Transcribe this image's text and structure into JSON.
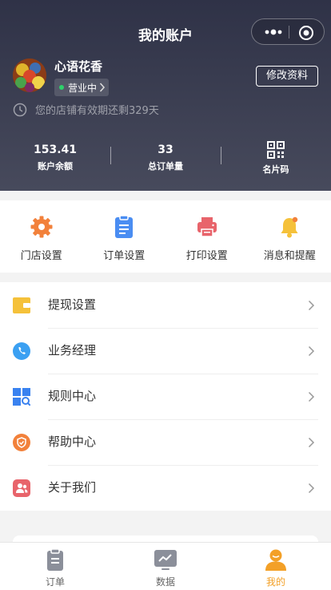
{
  "nav": {
    "title": "我的账户"
  },
  "profile": {
    "shop_name": "心语花香",
    "status": "营业中",
    "status_color": "#2ed06a",
    "edit_label": "修改资料",
    "validity_text": "您的店铺有效期还剩329天"
  },
  "stats": [
    {
      "value": "153.41",
      "label": "账户余额"
    },
    {
      "value": "33",
      "label": "总订单量"
    },
    {
      "icon": "qr-code-icon",
      "label": "名片码"
    }
  ],
  "quick_actions": [
    {
      "label": "门店设置",
      "icon": "gear-icon",
      "color": "#f2813b"
    },
    {
      "label": "订单设置",
      "icon": "clipboard-icon",
      "color": "#4a8df2"
    },
    {
      "label": "打印设置",
      "icon": "printer-icon",
      "color": "#e8646b"
    },
    {
      "label": "消息和提醒",
      "icon": "bell-icon",
      "color": "#f5c13a"
    }
  ],
  "menu": [
    {
      "label": "提现设置",
      "icon": "wallet-icon",
      "color": "#f5c13a"
    },
    {
      "label": "业务经理",
      "icon": "phone-icon",
      "color": "#3ba0f2"
    },
    {
      "label": "规则中心",
      "icon": "rules-grid-icon",
      "color": "#3a82f0"
    },
    {
      "label": "帮助中心",
      "icon": "shield-icon",
      "color": "#f2813b"
    },
    {
      "label": "关于我们",
      "icon": "people-icon",
      "color": "#e8646b"
    }
  ],
  "tabbar": [
    {
      "label": "订单",
      "icon": "order-tab-icon",
      "active": false
    },
    {
      "label": "数据",
      "icon": "data-tab-icon",
      "active": false
    },
    {
      "label": "我的",
      "icon": "me-tab-icon",
      "active": true,
      "color": "#f3a027"
    }
  ]
}
